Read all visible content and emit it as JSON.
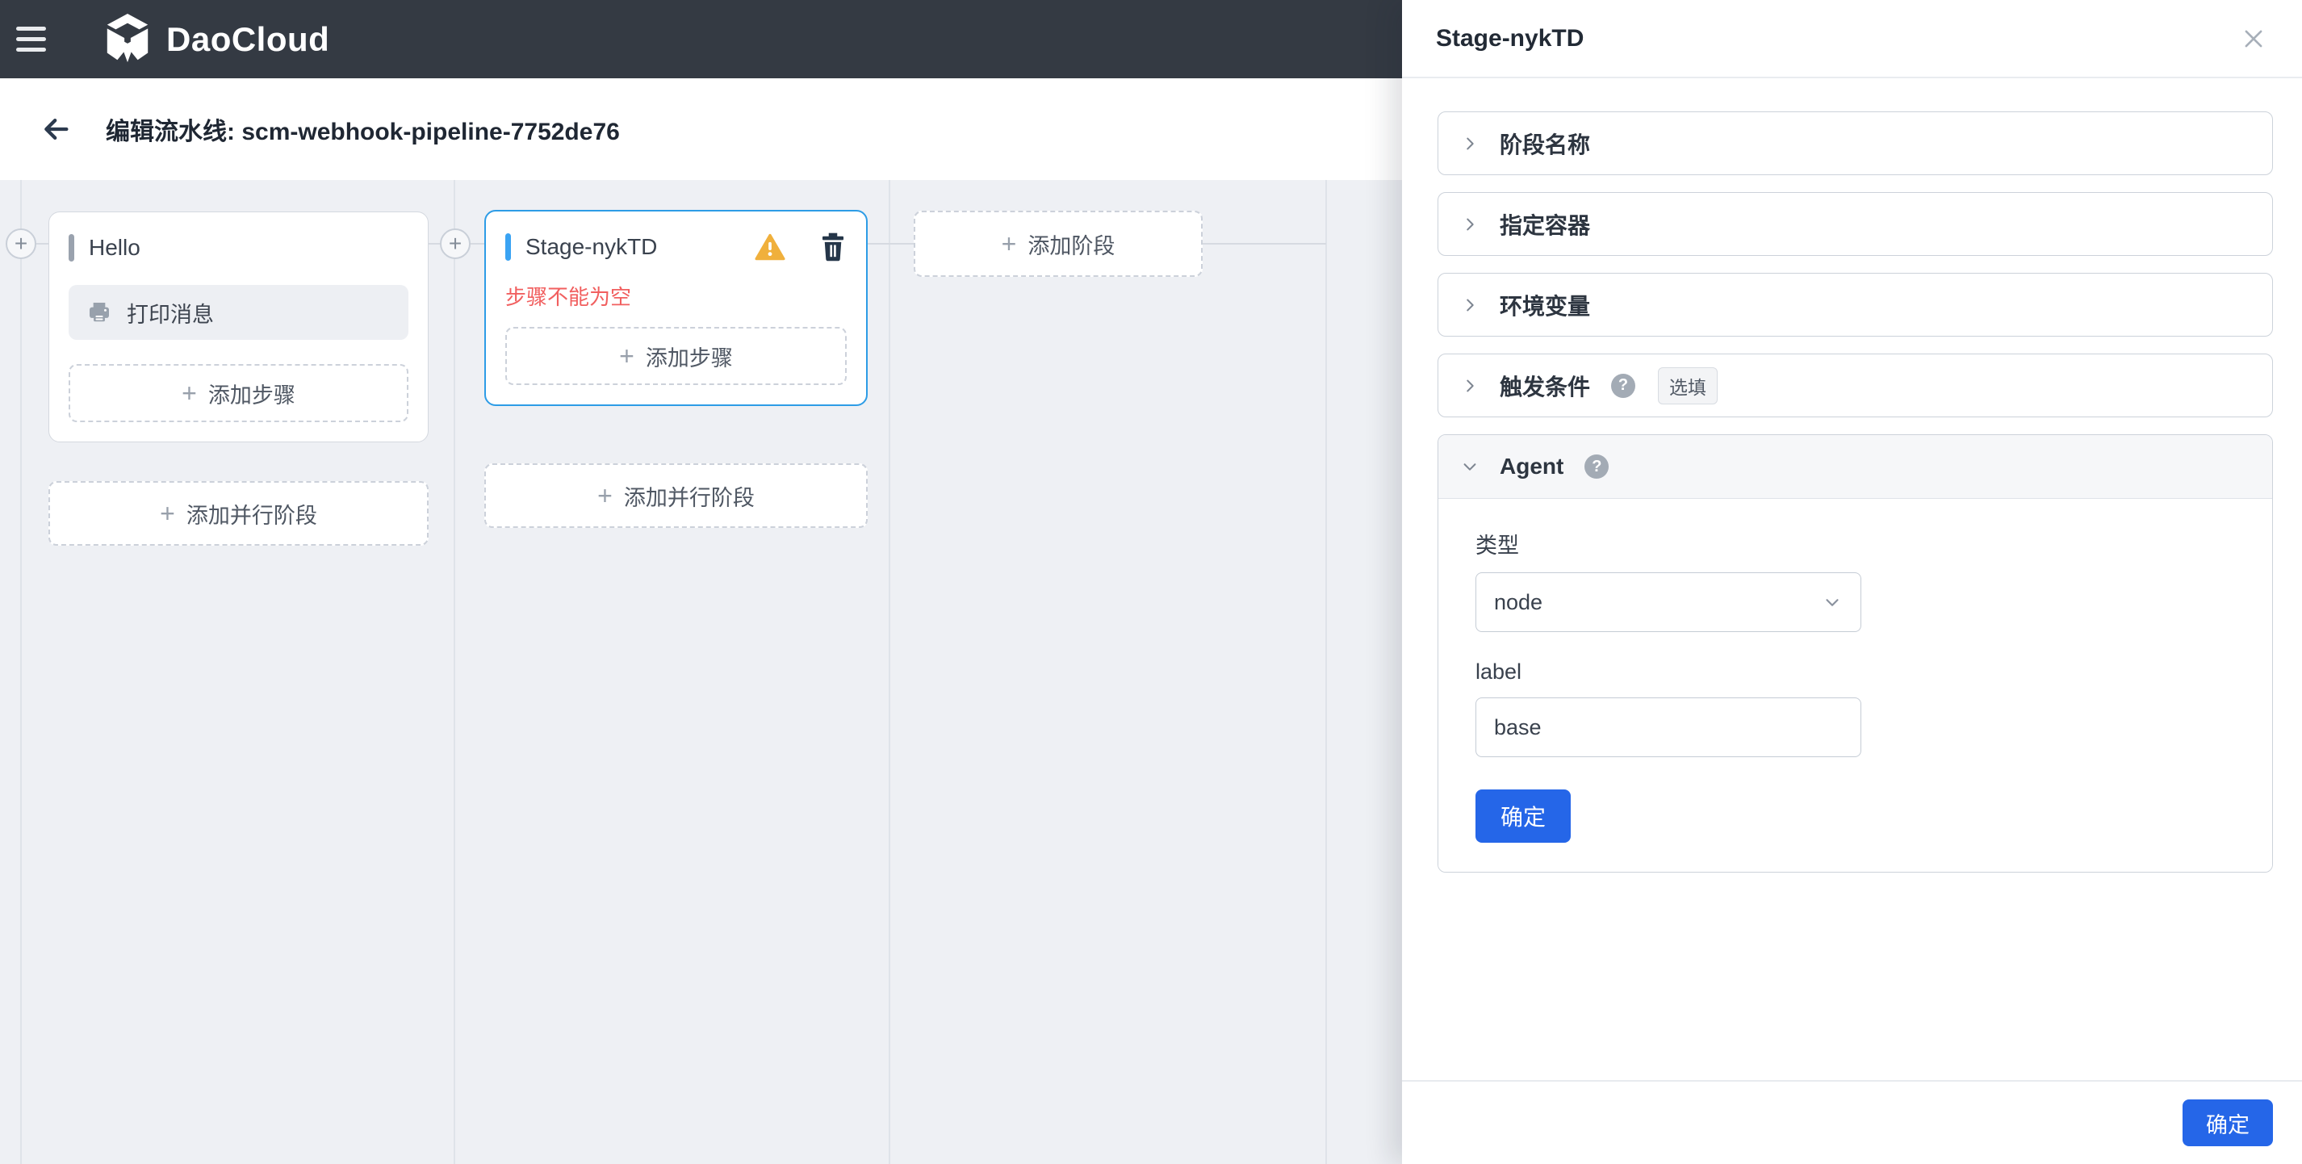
{
  "colors": {
    "header_bg": "#343a43",
    "canvas_bg": "#eef0f4",
    "selected_stage_border": "#2d9ce6",
    "stage_accent_blue": "#3aa3f3",
    "primary_button_blue": "#2566e8",
    "warning_yellow": "#f0b03c",
    "error_red": "#f15f5f"
  },
  "icons": {
    "plus": "+",
    "help": "?"
  },
  "header": {
    "brand": "DaoCloud"
  },
  "title_bar": {
    "title": "编辑流水线: scm-webhook-pipeline-7752de76"
  },
  "canvas": {
    "stage1": {
      "name": "Hello",
      "step": "打印消息",
      "add_step": "添加步骤",
      "add_parallel": "添加并行阶段"
    },
    "stage2": {
      "name": "Stage-nykTD",
      "error": "步骤不能为空",
      "add_step": "添加步骤",
      "add_parallel": "添加并行阶段"
    },
    "add_stage": "添加阶段"
  },
  "drawer": {
    "title": "Stage-nykTD",
    "sections": [
      {
        "label": "阶段名称"
      },
      {
        "label": "指定容器"
      },
      {
        "label": "环境变量"
      },
      {
        "label": "触发条件",
        "badge": "选填"
      },
      {
        "label": "Agent"
      }
    ],
    "agent_form": {
      "type_label": "类型",
      "type_value": "node",
      "name_label": "label",
      "name_value": "base",
      "confirm": "确定"
    },
    "footer": {
      "confirm": "确定"
    }
  }
}
